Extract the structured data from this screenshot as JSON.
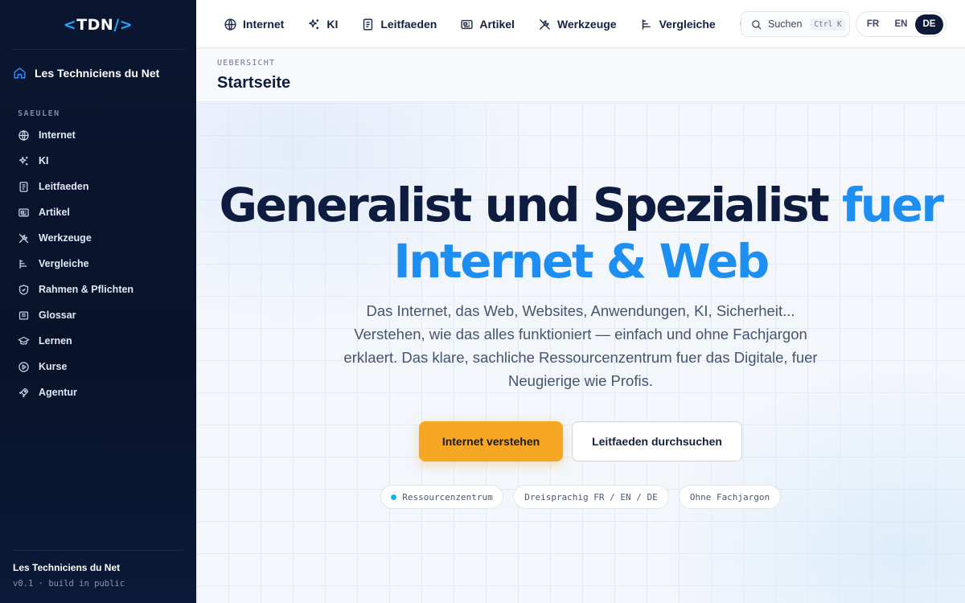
{
  "logo": {
    "open": "<",
    "name": "TDN",
    "close": "/>"
  },
  "sidebar": {
    "site_name": "Les Techniciens du Net",
    "section_label": "SAEULEN",
    "items": [
      {
        "label": "Internet",
        "icon": "globe-icon"
      },
      {
        "label": "KI",
        "icon": "sparkles-icon"
      },
      {
        "label": "Leitfaeden",
        "icon": "document-icon"
      },
      {
        "label": "Artikel",
        "icon": "newspaper-icon"
      },
      {
        "label": "Werkzeuge",
        "icon": "tools-icon"
      },
      {
        "label": "Vergleiche",
        "icon": "bars-icon"
      },
      {
        "label": "Rahmen & Pflichten",
        "icon": "shield-icon"
      },
      {
        "label": "Glossar",
        "icon": "book-icon"
      },
      {
        "label": "Lernen",
        "icon": "graduation-cap-icon"
      },
      {
        "label": "Kurse",
        "icon": "play-circle-icon"
      },
      {
        "label": "Agentur",
        "icon": "rocket-icon"
      }
    ],
    "footer_title": "Les Techniciens du Net",
    "footer_version": "v0.1 · build in public"
  },
  "topnav": {
    "items": [
      {
        "label": "Internet",
        "icon": "globe-icon"
      },
      {
        "label": "KI",
        "icon": "sparkles-icon"
      },
      {
        "label": "Leitfaeden",
        "icon": "document-icon"
      },
      {
        "label": "Artikel",
        "icon": "newspaper-icon"
      },
      {
        "label": "Werkzeuge",
        "icon": "tools-icon"
      },
      {
        "label": "Vergleiche",
        "icon": "bars-icon"
      }
    ],
    "search_label": "Suchen",
    "search_shortcut": "Ctrl K",
    "languages": [
      "FR",
      "EN",
      "DE"
    ],
    "active_language": "DE"
  },
  "page": {
    "breadcrumb": "UEBERSICHT",
    "title": "Startseite"
  },
  "hero": {
    "headline_main": "Generalist und Spezialist ",
    "headline_accent": "fuer",
    "headline_line2": "Internet & Web",
    "lead": "Das Internet, das Web, Websites, Anwendungen, KI, Sicherheit... Verstehen, wie das alles funktioniert — einfach und ohne Fachjargon erklaert. Das klare, sachliche Ressourcenzentrum fuer das Digitale, fuer Neugierige wie Profis.",
    "primary_cta": "Internet verstehen",
    "secondary_cta": "Leitfaeden durchsuchen",
    "chips": [
      "Ressourcenzentrum",
      "Dreisprachig FR / EN / DE",
      "Ohne Fachjargon"
    ]
  },
  "colors": {
    "sidebar_bg": "#0a1630",
    "accent_blue": "#1e8ff2",
    "cta_orange": "#f5a623",
    "headline_navy": "#0d1c3f"
  }
}
